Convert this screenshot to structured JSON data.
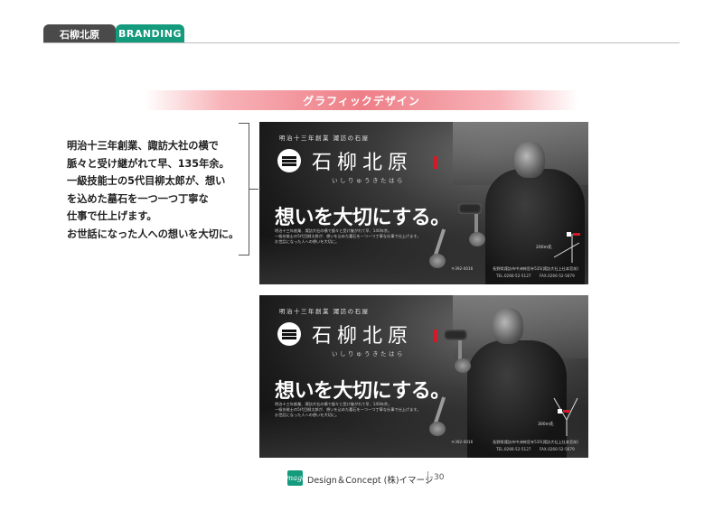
{
  "header": {
    "tab_company": "石柳北原",
    "tab_section": "BRANDING"
  },
  "banner": {
    "title": "グラフィックデザイン"
  },
  "description": {
    "lines": [
      "明治十三年創業、諏訪大社の横で",
      "脈々と受け継がれて早、135年余。",
      "一級技能士の5代目柳太郎が、想い",
      "を込めた墓石を一つ一つ丁寧な",
      "仕事で仕上げます。",
      "お世話になった人への想いを大切に。"
    ]
  },
  "ads": [
    {
      "tagline": "明治十三年創業 諏訪の石屋",
      "brand": "石柳北原",
      "reading": "いしりゅうきたはら",
      "headline": "想いを大切にする。",
      "body": [
        "明治十三年創業、諏訪大社の横で脈々と受け継がれて早、140年余。",
        "一級技能士の5代目柳太郎が、想いを込めた墓石を一つ一つ丁寧な仕事で仕上げます。",
        "お世話になった人への想いを大切に。"
      ],
      "zip": "〒392-0016",
      "address": "長野県諏訪市中洲神宮寺535(諏訪大社上社本宮前)",
      "tel": "TEL.0266-52-5127",
      "fax": "FAX.0266-52-5679",
      "map_distance": "200m先"
    },
    {
      "tagline": "明治十三年創業 諏訪の石屋",
      "brand": "石柳北原",
      "reading": "いしりゅうきたはら",
      "headline": "想いを大切にする。",
      "body": [
        "明治十三年創業、諏訪大社の横で脈々と受け継がれて早、140年余。",
        "一級技能士の5代目柳太郎が、想いを込めた墓石を一つ一つ丁寧な仕事で仕上げます。",
        "お世話になった人への想いを大切に。"
      ],
      "zip": "〒392-0016",
      "address": "長野県諏訪市中洲神宮寺535(諏訪大社上社本宮前)",
      "tel": "TEL.0266-52-5127",
      "fax": "FAX.0266-52-5679",
      "map_distance": "300m先"
    }
  ],
  "footer": {
    "logo_mark": "image",
    "company": "Design＆Concept (株)イマージ",
    "page_number": "30"
  },
  "colors": {
    "accent_green": "#149a7c",
    "tab_dark": "#4a4a4a",
    "banner_pink": "#ee7e87",
    "brand_red": "#d11a2a"
  }
}
